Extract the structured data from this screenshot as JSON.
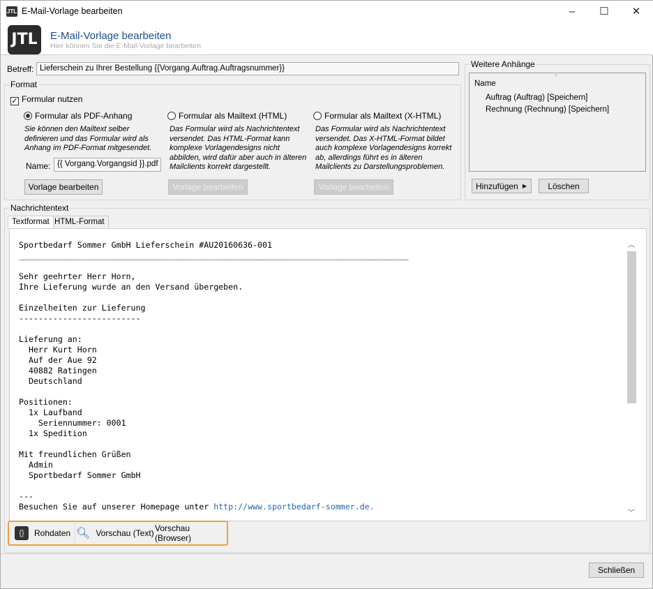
{
  "window": {
    "title": "E-Mail-Vorlage bearbeiten",
    "logo": "JTL",
    "minimize": "–",
    "maximize": "☐",
    "close": "✕"
  },
  "header": {
    "title": "E-Mail-Vorlage bearbeiten",
    "subtitle": "Hier können Sie die E-Mail-Vorlage bearbeiten"
  },
  "subject": {
    "label": "Betreff:",
    "value": "Lieferschein zu Ihrer Bestellung {{Vorgang.Auftrag.Auftragsnummer}}"
  },
  "format": {
    "group_label": "Format",
    "use_form_label": "Formular nutzen",
    "use_form_checked": true,
    "options": [
      {
        "label": "Formular als PDF-Anhang",
        "selected": true,
        "desc": "Sie können den Mailtext selber definieren und das Formular wird als Anhang im PDF-Format mitgesendet.",
        "button": "Vorlage bearbeiten",
        "enabled": true
      },
      {
        "label": "Formular als Mailtext (HTML)",
        "selected": false,
        "desc": "Das Formular wird als Nachrichtentext versendet. Das HTML-Format kann komplexe Vorlagendesigns nicht abbilden, wird dafür aber auch in älteren Mailclients korrekt dargestellt.",
        "button": "Vorlage bearbeiten",
        "enabled": false
      },
      {
        "label": "Formular als Mailtext (X-HTML)",
        "selected": false,
        "desc": "Das Formular wird als Nachrichtentext versendet. Das X-HTML-Format bildet auch komplexe Vorlagendesigns korrekt ab, allerdings führt es in älteren Mailclients zu Darstellungsproblemen.",
        "button": "Vorlage bearbeiten",
        "enabled": false
      }
    ],
    "name_label": "Name:",
    "name_value": "{{ Vorgang.Vorgangsid }}.pdf"
  },
  "attachments": {
    "group_label": "Weitere Anhänge",
    "column": "Name",
    "items": [
      "Auftrag (Auftrag) [Speichern]",
      "Rechnung (Rechnung) [Speichern]"
    ],
    "add_label": "Hinzufügen",
    "delete_label": "Löschen"
  },
  "message": {
    "group_label": "Nachrichtentext",
    "tabs": [
      "Textformat",
      "HTML-Format"
    ],
    "body": "Sportbedarf Sommer GmbH Lieferschein #AU20160636-001\n________________________________________________________________________________\n\nSehr geehrter Herr Horn,\nIhre Lieferung wurde an den Versand übergeben.\n\nEinzelheiten zur Lieferung\n-------------------------\n\nLieferung an:\n  Herr Kurt Horn\n  Auf der Aue 92\n  40882 Ratingen\n  Deutschland\n\nPositionen:\n  1x Laufband\n    Seriennummer: 0001\n  1x Spedition\n\nMit freundlichen Grüßen\n  Admin\n  Sportbedarf Sommer GmbH\n\n---\n",
    "last_line_prefix": "Besuchen Sie auf unserer Homepage unter ",
    "link": "http://www.sportbedarf-sommer.de."
  },
  "toolbar": {
    "raw": "Rohdaten",
    "preview_text": "Vorschau (Text)",
    "preview_browser": "Vorschau (Browser)",
    "highlight_color": "#f0a040"
  },
  "footer": {
    "close_label": "Schließen"
  }
}
